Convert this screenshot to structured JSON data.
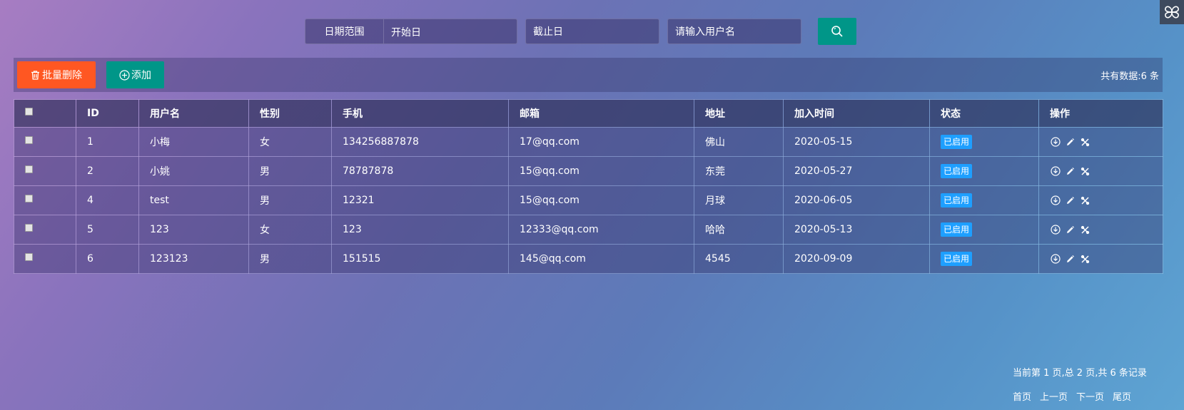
{
  "search": {
    "date_range_label": "日期范围",
    "start_placeholder": "开始日",
    "end_placeholder": "截止日",
    "username_placeholder": "请输入用户名",
    "search_icon": "search-icon"
  },
  "toolbar": {
    "batch_delete_label": "批量删除",
    "add_label": "添加",
    "total_text": "共有数据:6 条"
  },
  "table": {
    "headers": [
      "ID",
      "用户名",
      "性别",
      "手机",
      "邮箱",
      "地址",
      "加入时间",
      "状态",
      "操作"
    ],
    "rows": [
      {
        "id": "1",
        "username": "小梅",
        "gender": "女",
        "phone": "134256887878",
        "email": "17@qq.com",
        "address": "佛山",
        "joined": "2020-05-15",
        "status": "已启用"
      },
      {
        "id": "2",
        "username": "小姚",
        "gender": "男",
        "phone": "78787878",
        "email": "15@qq.com",
        "address": "东莞",
        "joined": "2020-05-27",
        "status": "已启用"
      },
      {
        "id": "4",
        "username": "test",
        "gender": "男",
        "phone": "12321",
        "email": "15@qq.com",
        "address": "月球",
        "joined": "2020-06-05",
        "status": "已启用"
      },
      {
        "id": "5",
        "username": "123",
        "gender": "女",
        "phone": "123",
        "email": "12333@qq.com",
        "address": "哈哈",
        "joined": "2020-05-13",
        "status": "已启用"
      },
      {
        "id": "6",
        "username": "123123",
        "gender": "男",
        "phone": "151515",
        "email": "145@qq.com",
        "address": "4545",
        "joined": "2020-09-09",
        "status": "已启用"
      }
    ]
  },
  "pagination": {
    "info": "当前第 1 页,总 2 页,共 6 条记录",
    "first": "首页",
    "prev": "上一页",
    "next": "下一页",
    "last": "尾页"
  },
  "colors": {
    "danger": "#ff5722",
    "primary": "#009688",
    "badge": "#1e9fff"
  }
}
